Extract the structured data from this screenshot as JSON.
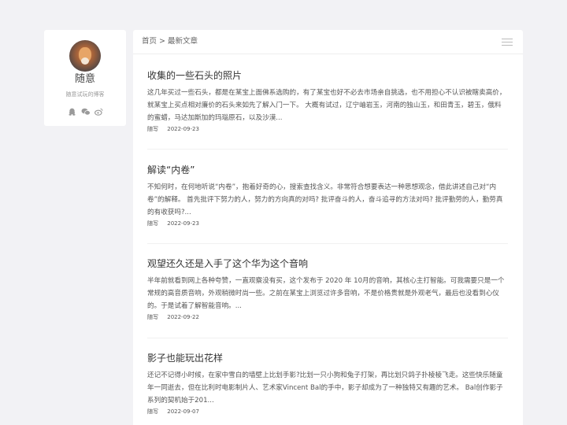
{
  "profile": {
    "name": "随意",
    "bio": "随意试玩的博客",
    "social_icons": [
      "qq-icon",
      "wechat-icon",
      "weibo-icon"
    ]
  },
  "breadcrumb": {
    "home": "首页",
    "separator": ">",
    "current": "最新文章"
  },
  "articles": [
    {
      "title": "收集的一些石头的照片",
      "excerpt": "这几年买过一些石头，都是在某宝上面佛系选购的，有了某宝也好不必去市场亲自挑选，也不用担心不认识被瞎卖高价，就某宝上买点相对廉价的石头来如先了解入门一下。 大概有试过，辽宁岫岩玉，河南的独山玉，和田青玉，碧玉，俄料的蜜蜡，马达加斯加的玛瑙原石，以及沙漠...",
      "category": "随写",
      "date": "2022-09-23"
    },
    {
      "title": "解读“内卷”",
      "excerpt": "不知何时，在何地听说“内卷”，抱着好奇的心，搜索查找含义。非常符合想要表达一种思想观念，借此讲述自己对“内卷”的解释。 首先批评下努力的人，努力的方向真的对吗? 批评奋斗的人，奋斗追寻的方法对吗? 批评勤劳的人，勤劳真的有收获吗?...",
      "category": "随写",
      "date": "2022-09-23"
    },
    {
      "title": "观望还久还是入手了这个华为这个音响",
      "excerpt": "半年前就看到网上各种夸赞，一直观察没有买，这个发布于 2020 年 10月的音响，其核心主打智能。可我需要只是一个常规的高音质音响，外观稍微时尚一些。之前在某宝上浏览过许多音响，不是价格贵就是外观老气，最后也没看到心仪的。于是试着了解智能音响。...",
      "category": "随写",
      "date": "2022-09-22"
    },
    {
      "title": "影子也能玩出花样",
      "excerpt": "还记不记得小时候，在家中雪白的墙壁上比划手影?比划一只小狗和兔子打架，再比划只鸽子扑棱棱飞走。这些快乐随童年一同逝去，但在比利时电影制片人、艺术家Vincent Bal的手中，影子却成为了一种独特又有趣的艺术。 Bal创作影子系列的契机始于201...",
      "category": "随写",
      "date": "2022-09-07"
    }
  ]
}
